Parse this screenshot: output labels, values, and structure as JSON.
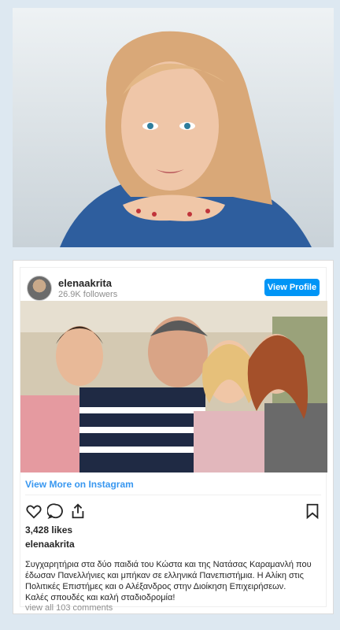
{
  "portrait": {
    "alt": "portrait photo"
  },
  "instagram": {
    "username": "elenaakrita",
    "followers": "26.9K followers",
    "view_profile_label": "View Profile",
    "view_more_label": "View More on Instagram",
    "likes": "3,428 likes",
    "caption_user": "elenaakrita",
    "caption_lines": [
      "Συγχαρητήρια στα δύο παιδιά του Κώστα και της Νατάσας Καραμανλή που",
      "έδωσαν Πανελλήνιες και μπήκαν σε ελληνικά Πανεπιστήμια. Η Αλίκη στις",
      "Πολιτικές Επιστήμες και ο Αλέξανδρος στην Διοίκηση Επιχειρήσεων.",
      "Καλές σπουδές και καλή σταδιοδρομία!"
    ],
    "comments_label": "view all 103 comments"
  },
  "colors": {
    "page_bg": "#dde8f1",
    "link_blue": "#3897f0",
    "button_blue": "#0095f6"
  },
  "icons": [
    "heart-icon",
    "comment-icon",
    "share-icon",
    "bookmark-icon"
  ]
}
